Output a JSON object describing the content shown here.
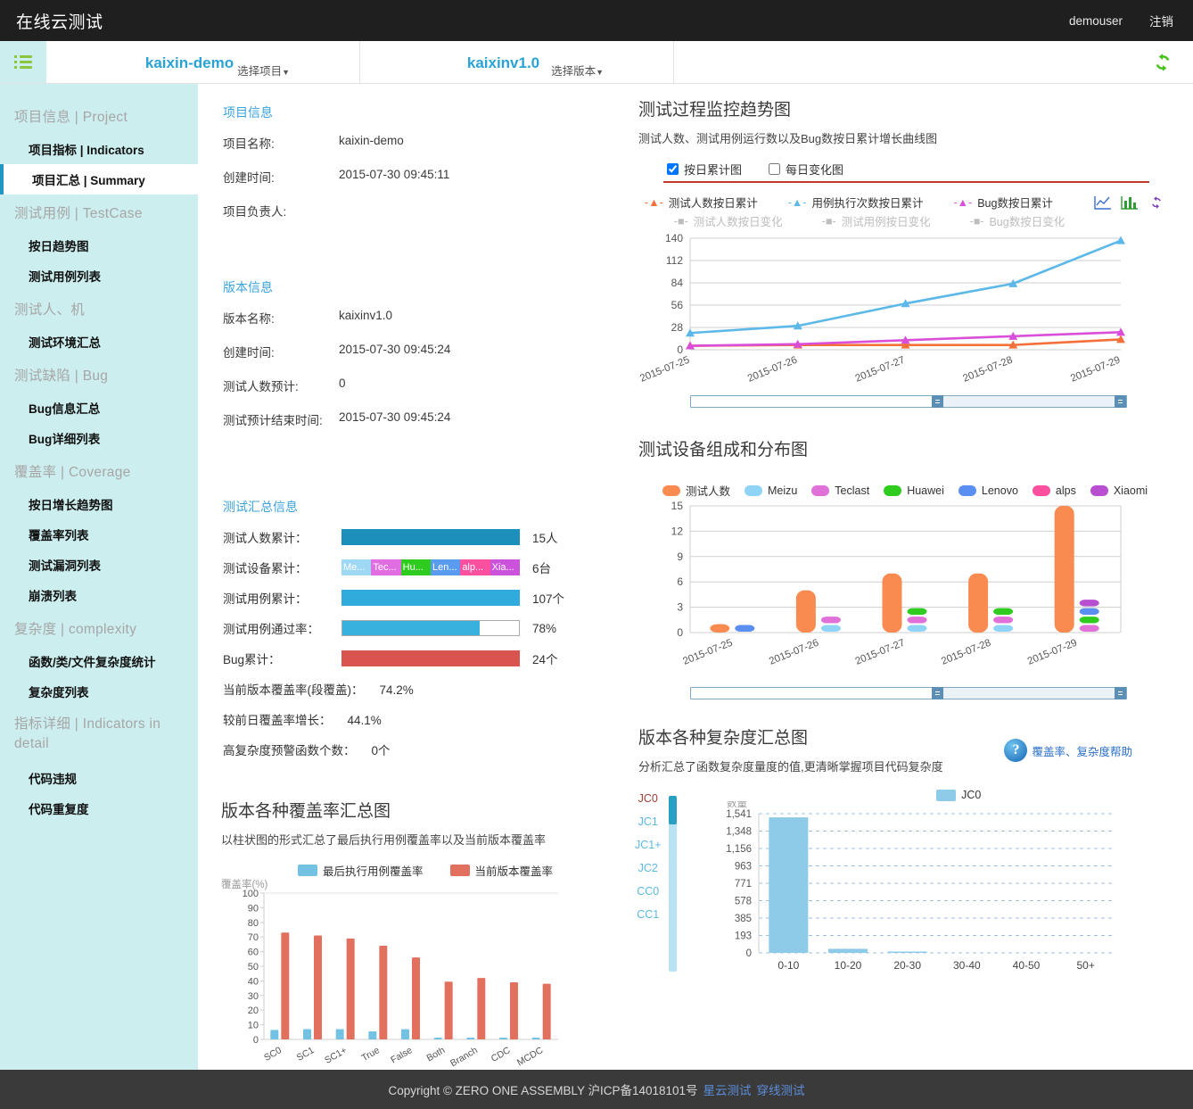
{
  "header": {
    "brand": "在线云测试",
    "user": "demouser",
    "logout": "注销"
  },
  "selector": {
    "project_name": "kaixin-demo",
    "project_sub": "选择项目",
    "version_name": "kaixinv1.0",
    "version_sub": "选择版本",
    "refresh_icon": "refresh-icon",
    "menu_icon": "menu-icon"
  },
  "sidebar": {
    "groups": [
      {
        "label": "项目信息 | Project",
        "items": [
          {
            "label": "项目指标 | Indicators",
            "active": false
          },
          {
            "label": "项目汇总 | Summary",
            "active": true
          }
        ]
      },
      {
        "label": "测试用例 | TestCase",
        "items": [
          {
            "label": "按日趋势图",
            "active": false
          },
          {
            "label": "测试用例列表",
            "active": false
          }
        ]
      },
      {
        "label": "测试人、机",
        "items": [
          {
            "label": "测试环境汇总",
            "active": false
          }
        ]
      },
      {
        "label": "测试缺陷 | Bug",
        "items": [
          {
            "label": "Bug信息汇总",
            "active": false
          },
          {
            "label": "Bug详细列表",
            "active": false
          }
        ]
      },
      {
        "label": "覆盖率 | Coverage",
        "items": [
          {
            "label": "按日增长趋势图",
            "active": false
          },
          {
            "label": "覆盖率列表",
            "active": false
          },
          {
            "label": "测试漏洞列表",
            "active": false
          },
          {
            "label": "崩溃列表",
            "active": false
          }
        ]
      },
      {
        "label": "复杂度 | complexity",
        "items": [
          {
            "label": "函数/类/文件复杂度统计",
            "active": false
          },
          {
            "label": "复杂度列表",
            "active": false
          }
        ]
      },
      {
        "label": "指标详细 | Indicators in detail",
        "items": [
          {
            "label": "代码违规",
            "active": false
          },
          {
            "label": "代码重复度",
            "active": false
          }
        ]
      }
    ]
  },
  "project_info": {
    "title": "项目信息",
    "rows": [
      {
        "k": "项目名称:",
        "v": "kaixin-demo"
      },
      {
        "k": "创建时间:",
        "v": "2015-07-30 09:45:11"
      },
      {
        "k": "项目负责人:",
        "v": ""
      }
    ]
  },
  "version_info": {
    "title": "版本信息",
    "rows": [
      {
        "k": "版本名称:",
        "v": "kaixinv1.0"
      },
      {
        "k": "创建时间:",
        "v": "2015-07-30 09:45:24"
      },
      {
        "k": "测试人数预计:",
        "v": "0"
      },
      {
        "k": "测试预计结束时间:",
        "v": "2015-07-30 09:45:24"
      }
    ]
  },
  "summary_info": {
    "title": "测试汇总信息",
    "bars": [
      {
        "label": "测试人数累计：",
        "value": "15人",
        "kind": "solid",
        "color": "#1c8fba",
        "pct": 100
      },
      {
        "label": "测试设备累计：",
        "value": "6台",
        "kind": "segments",
        "segments": [
          {
            "text": "Me...",
            "color": "#9ed8f5"
          },
          {
            "text": "Tec...",
            "color": "#e06ee0"
          },
          {
            "text": "Hu...",
            "color": "#2fcc1f"
          },
          {
            "text": "Len...",
            "color": "#5a9bf0"
          },
          {
            "text": "alp...",
            "color": "#fc4fa0"
          },
          {
            "text": "Xia...",
            "color": "#cb53db"
          }
        ]
      },
      {
        "label": "测试用例累计：",
        "value": "107个",
        "kind": "solid",
        "color": "#31aadc",
        "pct": 100
      },
      {
        "label": "测试用例通过率：",
        "value": "78%",
        "kind": "outlined",
        "color": "#38b1de",
        "pct": 78
      },
      {
        "label": "Bug累计：",
        "value": "24个",
        "kind": "solid",
        "color": "#d9534f",
        "pct": 100
      }
    ],
    "texts": [
      {
        "label": "当前版本覆盖率(段覆盖)：",
        "num": "74.2%"
      },
      {
        "label": "较前日覆盖率增长：",
        "num": "44.1%"
      },
      {
        "label": "高复杂度预警函数个数：",
        "num": "0个"
      }
    ]
  },
  "trend_panel": {
    "title": "测试过程监控趋势图",
    "subtitle": "测试人数、测试用例运行数以及Bug数按日累计增长曲线图",
    "checkbox_cumulative": "按日累计图",
    "checkbox_daily": "每日变化图",
    "cumulative_checked": true,
    "daily_checked": false,
    "icons": [
      "line-chart-icon",
      "bar-chart-icon",
      "refresh-icon"
    ]
  },
  "device_panel": {
    "title": "测试设备组成和分布图"
  },
  "coverage_panel": {
    "title": "版本各种覆盖率汇总图",
    "subtitle": "以柱状图的形式汇总了最后执行用例覆盖率以及当前版本覆盖率"
  },
  "complexity_panel": {
    "title": "版本各种复杂度汇总图",
    "subtitle": "分析汇总了函数复杂度量度的值,更清晰掌握项目代码复杂度",
    "help_link": "覆盖率、复杂度帮助",
    "help_icon": "question-icon",
    "metrics": [
      "JC0",
      "JC1",
      "JC1+",
      "JC2",
      "CC0",
      "CC1"
    ],
    "selected_metric": "JC0"
  },
  "footer": {
    "copyright": "Copyright © ZERO ONE ASSEMBLY 沪ICP备14018101号",
    "link1": "星云测试",
    "link2": "穿线测试"
  },
  "chart_data": [
    {
      "id": "trend",
      "type": "line",
      "title": "测试过程监控趋势图",
      "xlabel": "",
      "ylabel": "",
      "x": [
        "2015-07-25",
        "2015-07-26",
        "2015-07-27",
        "2015-07-28",
        "2015-07-29"
      ],
      "yticks": [
        0,
        28,
        56,
        84,
        112,
        140
      ],
      "ylim": [
        0,
        140
      ],
      "grid": true,
      "legend_position": "top",
      "series": [
        {
          "name": "测试人数按日累计",
          "color": "#f4703a",
          "values": [
            5,
            6,
            6,
            6,
            13
          ],
          "active": true
        },
        {
          "name": "用例执行次数按日累计",
          "color": "#5bb8e8",
          "values": [
            21,
            30,
            58,
            83,
            137
          ],
          "active": true
        },
        {
          "name": "Bug数按日累计",
          "color": "#d94fd9",
          "values": [
            5,
            7,
            12,
            17,
            22
          ],
          "active": true
        },
        {
          "name": "测试人数按日变化",
          "color": "#bdbdbd",
          "values": [],
          "active": false
        },
        {
          "name": "测试用例按日变化",
          "color": "#bdbdbd",
          "values": [],
          "active": false
        },
        {
          "name": "Bug数按日变化",
          "color": "#bdbdbd",
          "values": [],
          "active": false
        }
      ]
    },
    {
      "id": "devices",
      "type": "bar",
      "title": "测试设备组成和分布图",
      "categories": [
        "2015-07-25",
        "2015-07-26",
        "2015-07-27",
        "2015-07-28",
        "2015-07-29"
      ],
      "yticks": [
        0,
        3,
        6,
        9,
        12,
        15
      ],
      "ylim": [
        0,
        15
      ],
      "grid": true,
      "legend_position": "top",
      "series": [
        {
          "name": "测试人数",
          "color": "#fa8b50",
          "values": [
            1,
            5,
            7,
            7,
            15
          ]
        },
        {
          "name": "Meizu",
          "color": "#8fd4f7",
          "values": [
            0,
            1,
            1,
            1,
            0
          ]
        },
        {
          "name": "Teclast",
          "color": "#e071d9",
          "values": [
            0,
            1,
            1,
            1,
            1
          ]
        },
        {
          "name": "Huawei",
          "color": "#2fcc1f",
          "values": [
            0,
            0,
            1,
            1,
            1
          ]
        },
        {
          "name": "Lenovo",
          "color": "#5a8ef0",
          "values": [
            1,
            0,
            0,
            0,
            1
          ]
        },
        {
          "name": "alps",
          "color": "#fc4fa0",
          "values": [
            0,
            0,
            0,
            0,
            0
          ]
        },
        {
          "name": "Xiaomi",
          "color": "#b84fd1",
          "values": [
            0,
            0,
            0,
            0,
            1
          ]
        }
      ]
    },
    {
      "id": "coverage",
      "type": "bar",
      "title": "版本各种覆盖率汇总图",
      "ylabel": "覆盖率(%)",
      "categories": [
        "SC0",
        "SC1",
        "SC1+",
        "True",
        "False",
        "Both",
        "Branch",
        "CDC",
        "MCDC"
      ],
      "yticks": [
        0,
        10,
        20,
        30,
        40,
        50,
        60,
        70,
        80,
        90,
        100
      ],
      "ylim": [
        0,
        100
      ],
      "grid": false,
      "legend_position": "top",
      "series": [
        {
          "name": "最后执行用例覆盖率",
          "color": "#74c2e3",
          "values": [
            6.5,
            7,
            7,
            5.5,
            7,
            1.2,
            1.2,
            1.2,
            1.2
          ]
        },
        {
          "name": "当前版本覆盖率",
          "color": "#e2705f",
          "values": [
            73,
            71,
            69,
            64,
            56,
            39.5,
            42,
            39,
            38
          ]
        }
      ]
    },
    {
      "id": "complexity",
      "type": "bar",
      "title": "版本各种复杂度汇总图",
      "ylabel": "数量",
      "categories": [
        "0-10",
        "10-20",
        "20-30",
        "30-40",
        "40-50",
        "50+"
      ],
      "yticks": [
        0,
        193,
        385,
        578,
        771,
        963,
        1156,
        1348,
        1541
      ],
      "ytick_labels": [
        "0",
        "193",
        "385",
        "578",
        "771",
        "963",
        "1,156",
        "1,348",
        "1,541"
      ],
      "ylim": [
        0,
        1541
      ],
      "grid": true,
      "legend_position": "top",
      "series": [
        {
          "name": "JC0",
          "color": "#8ecbe8",
          "values": [
            1500,
            45,
            15,
            0,
            0,
            0
          ]
        }
      ]
    }
  ]
}
